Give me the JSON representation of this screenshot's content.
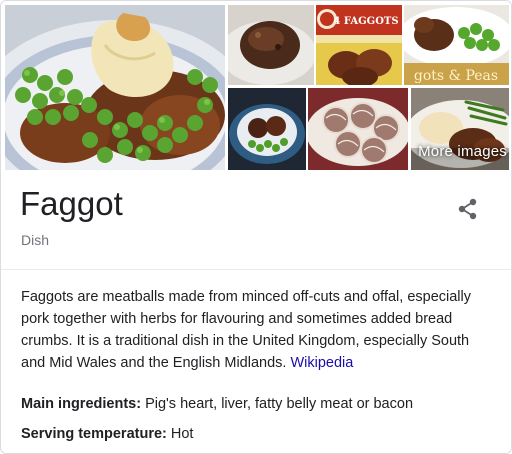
{
  "collage": {
    "more_images_label": "More images",
    "tiles": [
      {
        "name": "main",
        "icon": "faggots-with-mash-and-peas-photo"
      },
      {
        "name": "a",
        "icon": "faggot-close-up-photo"
      },
      {
        "name": "b",
        "icon": "faggots-packaging-photo",
        "pack_label": "4 FAGGOTS"
      },
      {
        "name": "c",
        "icon": "faggots-and-peas-photo",
        "banner_text": "gots & Peas"
      },
      {
        "name": "d",
        "icon": "faggots-on-plate-photo"
      },
      {
        "name": "e",
        "icon": "caul-wrapped-faggots-photo"
      },
      {
        "name": "f",
        "icon": "faggots-with-green-beans-photo"
      }
    ]
  },
  "header": {
    "title": "Faggot",
    "subtitle": "Dish",
    "share_icon": "share-icon"
  },
  "description": {
    "text": "Faggots are meatballs made from minced off-cuts and offal, especially pork together with herbs for flavouring and sometimes added bread crumbs. It is a traditional dish in the United Kingdom, especially South and Mid Wales and the English Midlands.",
    "source_link": "Wikipedia"
  },
  "facts": [
    {
      "label": "Main ingredients:",
      "value": "Pig's heart, liver, fatty belly meat or bacon"
    },
    {
      "label": "Serving temperature:",
      "value": "Hot"
    }
  ]
}
